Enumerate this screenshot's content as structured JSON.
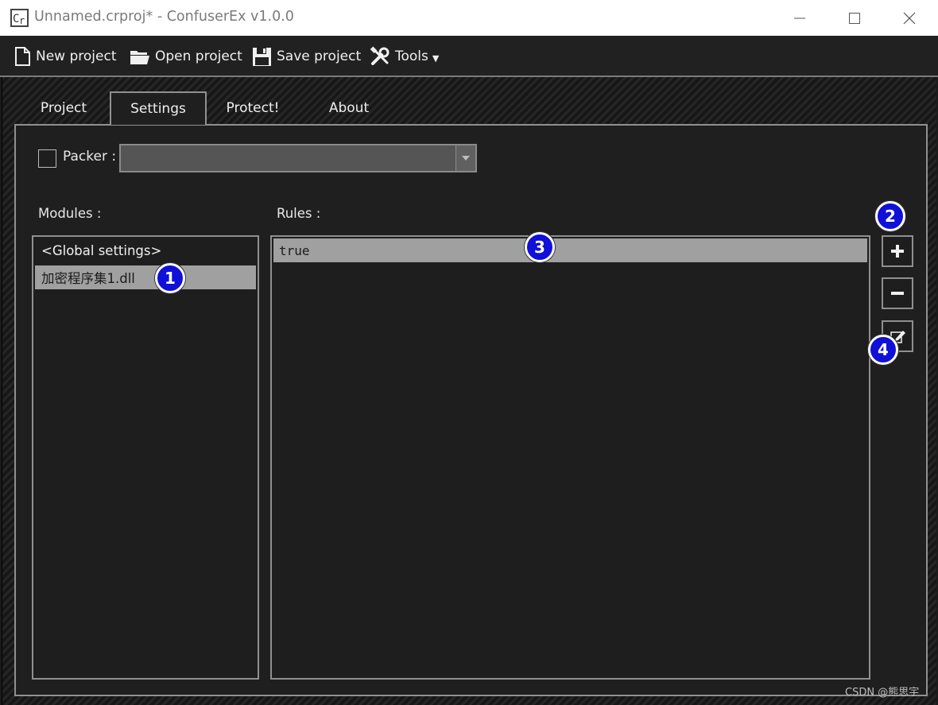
{
  "window": {
    "title": "Unnamed.crproj* - ConfuserEx v1.0.0",
    "icon": "confuserex-app-icon"
  },
  "toolbar": {
    "new_project": "New project",
    "open_project": "Open project",
    "save_project": "Save project",
    "tools": "Tools"
  },
  "tabs": [
    {
      "label": "Project",
      "selected": false
    },
    {
      "label": "Settings",
      "selected": true
    },
    {
      "label": "Protect!",
      "selected": false
    },
    {
      "label": "About",
      "selected": false
    }
  ],
  "settings": {
    "packer_label": "Packer :",
    "packer_checked": false,
    "packer_value": "",
    "modules_label": "Modules :",
    "rules_label": "Rules :",
    "modules": [
      "<Global settings>",
      "加密程序集1.dll"
    ],
    "selected_module": "加密程序集1.dll",
    "rules": [
      "true"
    ]
  },
  "annotations": [
    "1",
    "2",
    "3",
    "4"
  ],
  "watermark": "CSDN @熊思宇",
  "colors": {
    "badge": "#1010d8",
    "selection": "#a0a0a0",
    "panel": "#1f1f1f",
    "border": "#909090"
  }
}
